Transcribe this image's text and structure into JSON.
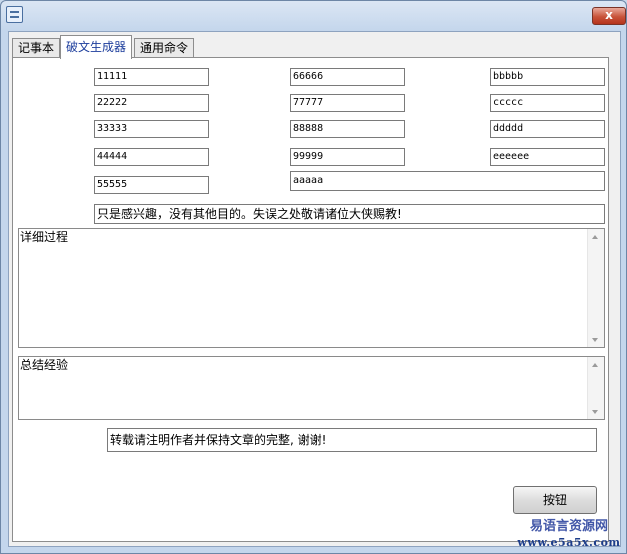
{
  "window": {
    "close_symbol": "x"
  },
  "tabs": [
    {
      "label": "记事本"
    },
    {
      "label": "破文生成器"
    },
    {
      "label": "通用命令"
    }
  ],
  "fields": {
    "c1": [
      "11111",
      "22222",
      "33333",
      "44444",
      "55555"
    ],
    "c2": [
      "66666",
      "77777",
      "88888",
      "99999"
    ],
    "c3": [
      "bbbbb",
      "ccccc",
      "ddddd",
      "eeeeee"
    ],
    "wide": "aaaaa"
  },
  "note_line": "只是感兴趣，没有其他目的。失误之处敬请诸位大侠赐教!",
  "memo_detail": "详细过程",
  "memo_summary": "总结经验",
  "footer_line": "转载请注明作者并保持文章的完整, 谢谢!",
  "button_label": "按钮",
  "watermark": {
    "line1": "易语言资源网",
    "line2": "www.e5a5x.com"
  },
  "colors": {
    "title_bar": "#c4d6ec",
    "close": "#c8533a",
    "active_tab_text": "#1c3d9c"
  }
}
